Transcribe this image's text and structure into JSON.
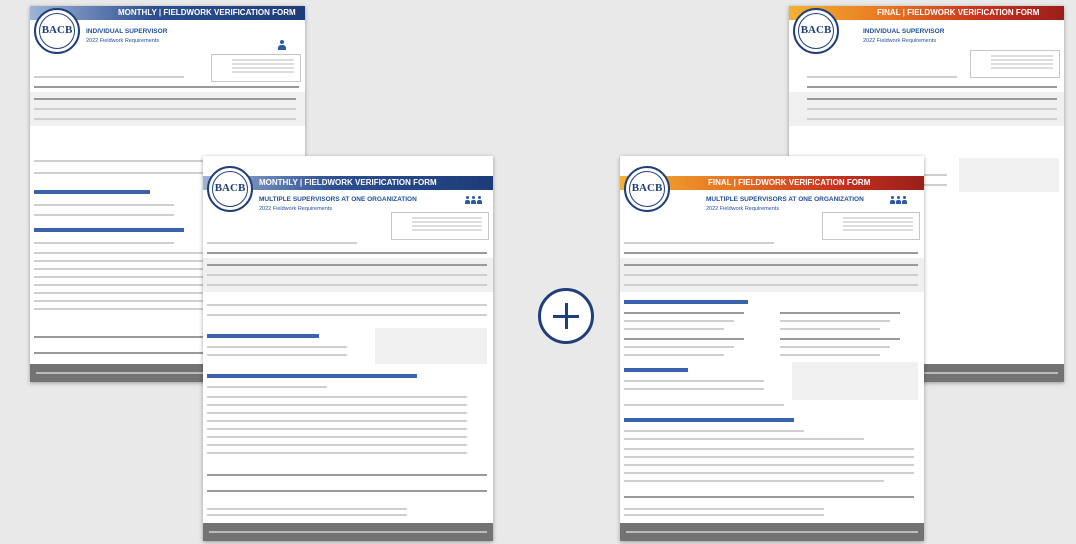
{
  "documents": [
    {
      "title": "MONTHLY | FIELDWORK VERIFICATION FORM",
      "logo": "BACB",
      "subtitle": "INDIVIDUAL SUPERVISOR",
      "requirements": "2022 Fieldwork Requirements",
      "icon": "single-person-icon"
    },
    {
      "title": "MONTHLY | FIELDWORK VERIFICATION FORM",
      "logo": "BACB",
      "subtitle": "MULTIPLE SUPERVISORS AT ONE ORGANIZATION",
      "requirements": "2022 Fieldwork Requirements",
      "icon": "group-icon"
    },
    {
      "title": "FINAL | FIELDWORK VERIFICATION FORM",
      "logo": "BACB",
      "subtitle": "INDIVIDUAL SUPERVISOR",
      "requirements": "2022 Fieldwork Requirements",
      "icon": "single-person-icon"
    },
    {
      "title": "FINAL | FIELDWORK VERIFICATION FORM",
      "logo": "BACB",
      "subtitle": "MULTIPLE SUPERVISORS AT ONE ORGANIZATION",
      "requirements": "2022 Fieldwork Requirements",
      "icon": "group-icon"
    }
  ],
  "connector": {
    "symbol": "plus-icon"
  },
  "colors": {
    "background": "#e9e9ea",
    "monthly_band": "#1d3b78",
    "final_band": "#c8321e",
    "heading": "#1f4e9c"
  }
}
